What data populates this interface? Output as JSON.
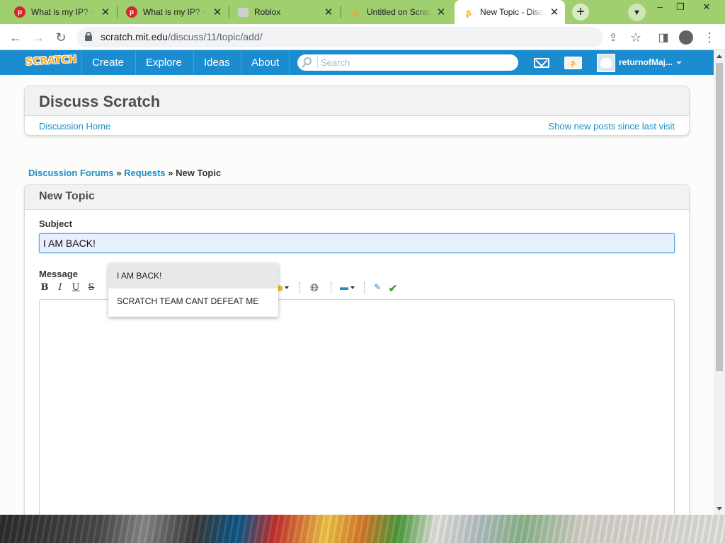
{
  "browser": {
    "tabs": [
      {
        "title": "What is my IP? - W",
        "favicon": "pinterest-icon",
        "active": false
      },
      {
        "title": "What is my IP? - W",
        "favicon": "pinterest-icon",
        "active": false
      },
      {
        "title": "Roblox",
        "favicon": "roblox-icon",
        "active": false
      },
      {
        "title": "Untitled on Scratch",
        "favicon": "scratch-cat-icon",
        "active": false
      },
      {
        "title": "New Topic - Discuss",
        "favicon": "scratch-cat-icon",
        "active": true
      }
    ],
    "url_host": "scratch.mit.edu",
    "url_path": "/discuss/11/topic/add/"
  },
  "scratch_nav": {
    "logo": "SCRATCH",
    "links": [
      "Create",
      "Explore",
      "Ideas",
      "About"
    ],
    "search_placeholder": "Search",
    "username": "returnofMaj...",
    "colors": {
      "nav_bg": "#1b8ccf",
      "logo": "#f9a825"
    }
  },
  "discuss": {
    "title": "Discuss Scratch",
    "home_link": "Discussion Home",
    "new_posts_link": "Show new posts since last visit"
  },
  "breadcrumb": {
    "forums": "Discussion Forums",
    "sep1": "»",
    "requests": "Requests",
    "sep2": "»",
    "current": "New Topic"
  },
  "form": {
    "heading": "New Topic",
    "subject_label": "Subject",
    "subject_value": "I AM BACK!",
    "message_label": "Message",
    "message_value": "",
    "toolbar": {
      "bold": "B",
      "italic": "I",
      "underline": "U",
      "strike": "S"
    },
    "autocomplete": [
      "I AM BACK!",
      "SCRATCH TEAM CANT DEFEAT  ME"
    ]
  }
}
